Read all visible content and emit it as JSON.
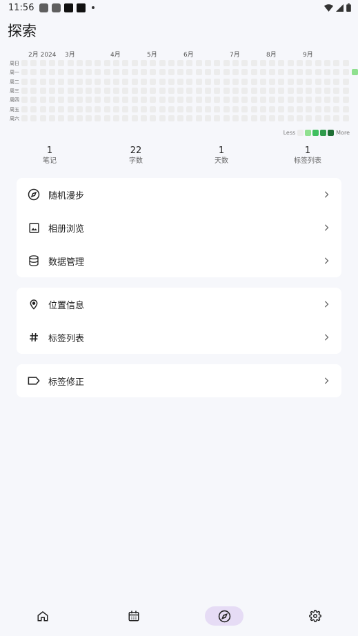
{
  "status_bar": {
    "time": "11:56"
  },
  "page": {
    "title": "探索"
  },
  "heatmap": {
    "months": [
      "2月 2024",
      "3月",
      "4月",
      "5月",
      "6月",
      "7月",
      "8月",
      "9月"
    ],
    "weekdays": [
      "周日",
      "周一",
      "周二",
      "周三",
      "周四",
      "周五",
      "周六"
    ],
    "active_days": [
      {
        "week": 36,
        "weekday": 1,
        "level": 1
      }
    ],
    "level_colors": [
      "#ececec",
      "#8fe08f",
      "#3fbf5f",
      "#2e9a4a",
      "#1f6f35"
    ],
    "legend": {
      "less": "Less",
      "more": "More"
    }
  },
  "stats": [
    {
      "value": "1",
      "label": "笔记"
    },
    {
      "value": "22",
      "label": "字数"
    },
    {
      "value": "1",
      "label": "天数"
    },
    {
      "value": "1",
      "label": "标签列表"
    }
  ],
  "groups": [
    [
      {
        "id": "random-walk",
        "icon": "compass-icon",
        "label": "随机漫步"
      },
      {
        "id": "album",
        "icon": "image-icon",
        "label": "相册浏览"
      },
      {
        "id": "data-manage",
        "icon": "database-icon",
        "label": "数据管理"
      }
    ],
    [
      {
        "id": "location",
        "icon": "location-pin-icon",
        "label": "位置信息"
      },
      {
        "id": "tag-list",
        "icon": "hashtag-icon",
        "label": "标签列表"
      }
    ],
    [
      {
        "id": "tag-fix",
        "icon": "label-icon",
        "label": "标签修正"
      }
    ]
  ],
  "bottom_nav": [
    {
      "id": "home",
      "icon": "home-icon",
      "active": false
    },
    {
      "id": "calendar",
      "icon": "calendar-icon",
      "active": false
    },
    {
      "id": "explore",
      "icon": "compass-icon",
      "active": true
    },
    {
      "id": "settings",
      "icon": "gear-icon",
      "active": false
    }
  ]
}
